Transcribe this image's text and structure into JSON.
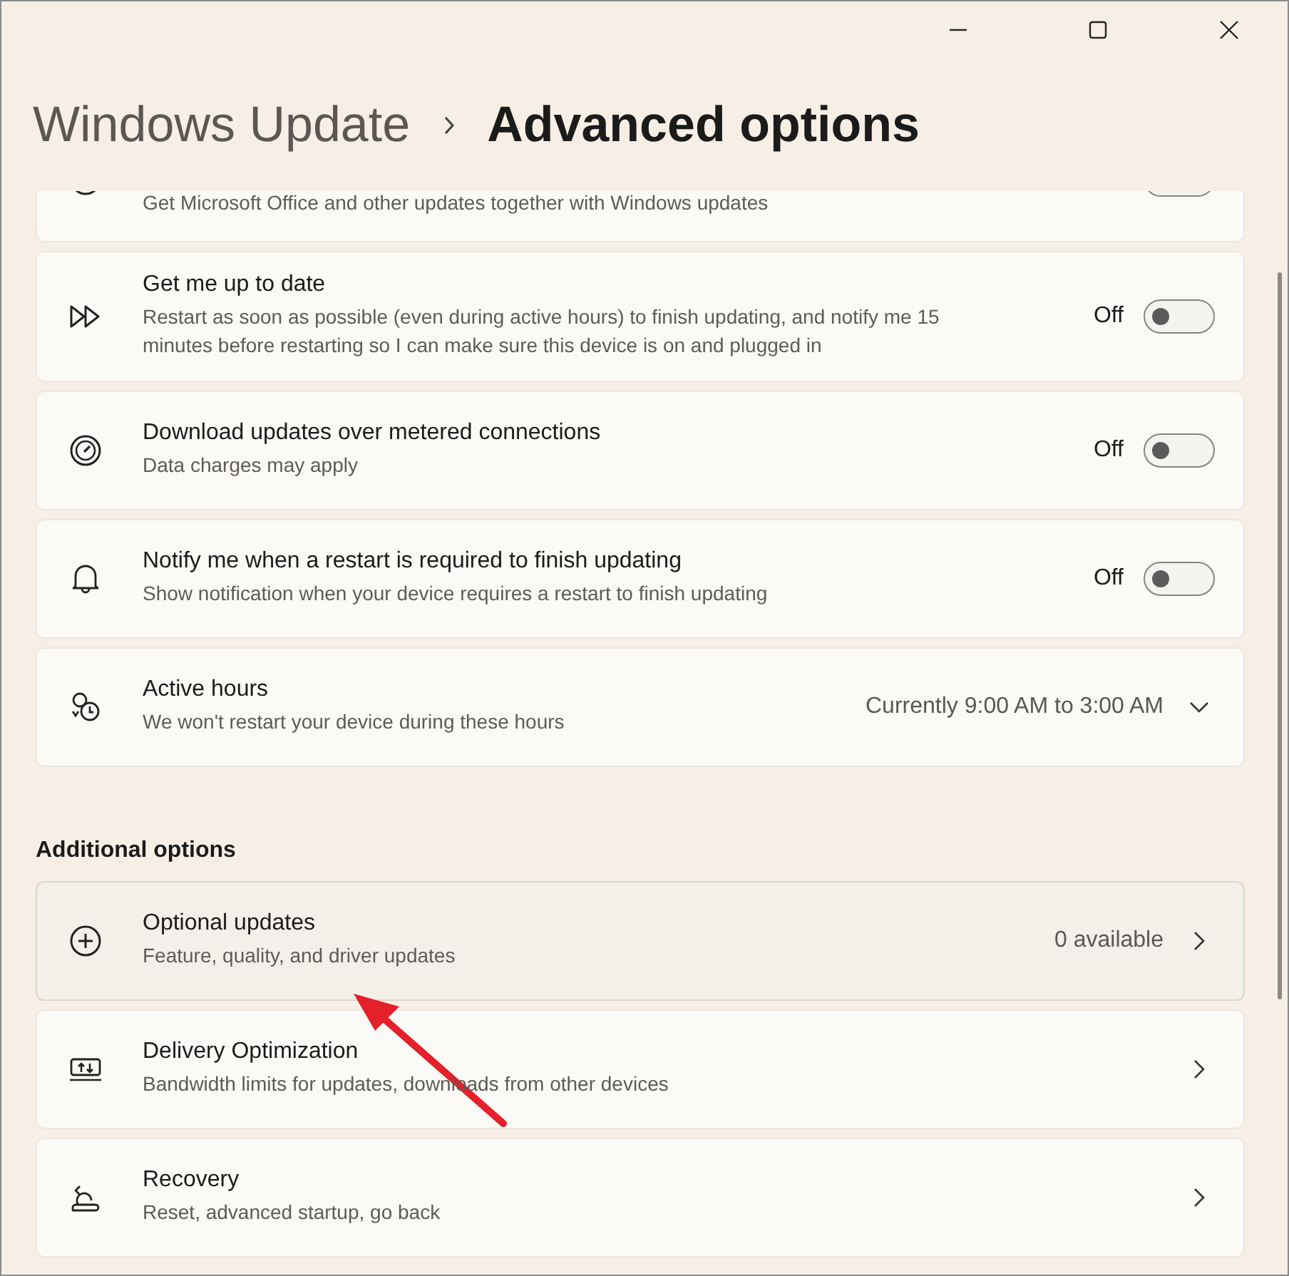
{
  "breadcrumb": {
    "parent": "Windows Update",
    "current": "Advanced options"
  },
  "settings": [
    {
      "kind": "toggle",
      "description": "Get Microsoft Office and other updates together with Windows updates",
      "on": false
    },
    {
      "kind": "toggle",
      "title": "Get me up to date",
      "description": "Restart as soon as possible (even during active hours) to finish updating, and notify me 15 minutes before restarting so I can make sure this device is on and plugged in",
      "state_label": "Off",
      "on": false
    },
    {
      "kind": "toggle",
      "title": "Download updates over metered connections",
      "description": "Data charges may apply",
      "state_label": "Off",
      "on": false
    },
    {
      "kind": "toggle",
      "title": "Notify me when a restart is required to finish updating",
      "description": "Show notification when your device requires a restart to finish updating",
      "state_label": "Off",
      "on": false
    },
    {
      "kind": "dropdown",
      "title": "Active hours",
      "description": "We won't restart your device during these hours",
      "value": "Currently 9:00 AM to 3:00 AM",
      "expanded": false
    }
  ],
  "additional": {
    "heading": "Additional options",
    "items": [
      {
        "title": "Optional updates",
        "description": "Feature, quality, and driver updates",
        "value": "0 available",
        "selected": true
      },
      {
        "title": "Delivery Optimization",
        "description": "Bandwidth limits for updates, downloads from other devices",
        "selected": false
      },
      {
        "title": "Recovery",
        "description": "Reset, advanced startup, go back",
        "selected": false
      }
    ]
  },
  "annotations": [
    {
      "kind": "arrow"
    }
  ]
}
